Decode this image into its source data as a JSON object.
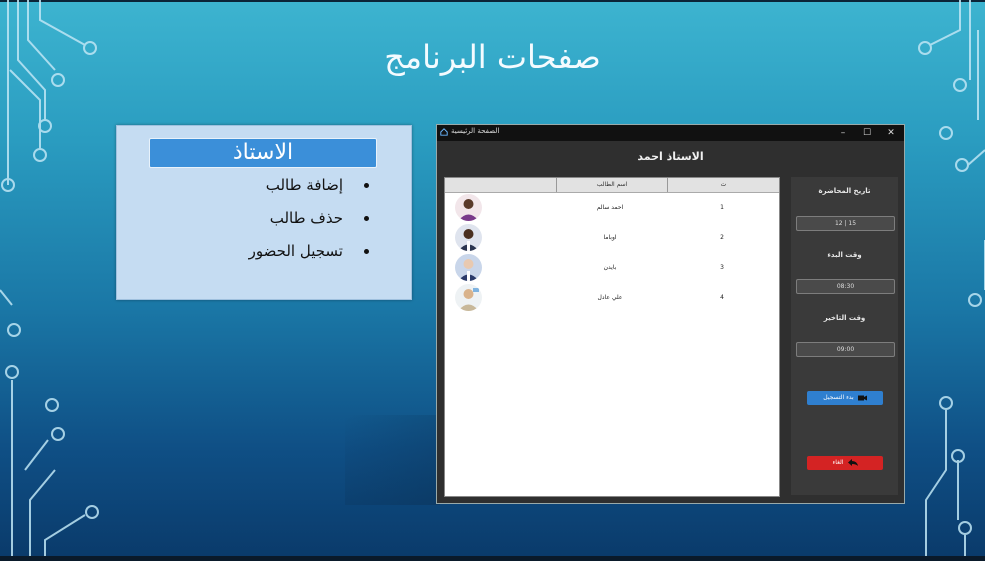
{
  "slide": {
    "title": "صفحات البرنامج"
  },
  "teacher_panel": {
    "heading": "الاستاذ",
    "items": [
      {
        "label": "إضافة طالب"
      },
      {
        "label": "حذف طالب"
      },
      {
        "label": "تسجيل الحضور"
      }
    ]
  },
  "app": {
    "window_title": "الصفحة الرئيسية",
    "header_title": "الاستاذ احمد",
    "controls": {
      "minimize": "–",
      "maximize": "☐",
      "close": "✕"
    },
    "list": {
      "columns": {
        "number": "ت",
        "name": "اسم الطالب"
      },
      "rows": [
        {
          "number": "1",
          "name": "احمد سالم",
          "avatar_color": "#7a3a8a"
        },
        {
          "number": "2",
          "name": "اوباما",
          "avatar_color": "#2b3550"
        },
        {
          "number": "3",
          "name": "بايدن",
          "avatar_color": "#2a3a6a"
        },
        {
          "number": "4",
          "name": "علي عادل",
          "avatar_color": "#c8b89a"
        }
      ]
    },
    "side": {
      "lecture_date_label": "تاريخ المحاضرة",
      "lecture_date_value": "12 | 15",
      "start_time_label": "وقت البدء",
      "start_time_value": "08:30",
      "late_time_label": "وقت التاخير",
      "late_time_value": "09:00",
      "start_record_label": "بدء التسجيل",
      "cancel_label": "الغاء",
      "record_color": "#2f7fcf",
      "cancel_color": "#d42323"
    }
  }
}
